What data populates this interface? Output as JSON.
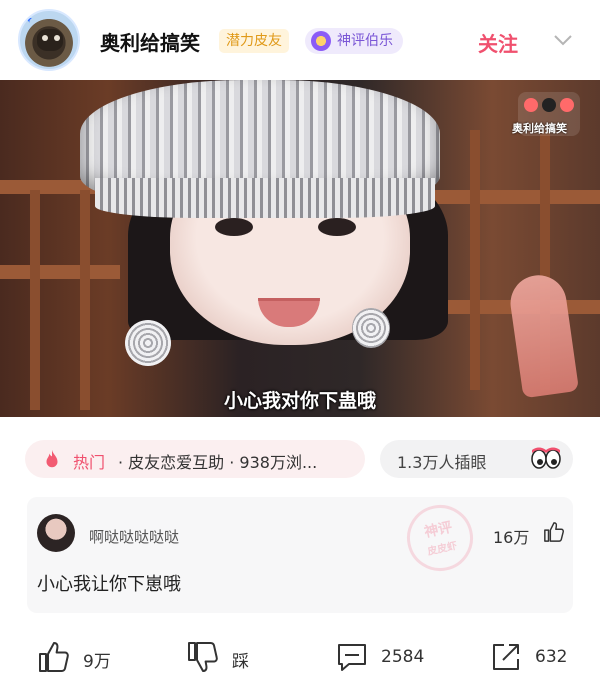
{
  "header": {
    "username": "奥利给搞笑",
    "badge_potential": "潜力皮友",
    "badge_review": "神评伯乐",
    "follow_label": "关注"
  },
  "video": {
    "watermark": "奥利给搞笑",
    "subtitle": "小心我对你下蛊哦"
  },
  "hot_bar": {
    "label": "热门",
    "text": "· 皮友恋爱互助 · 938万浏..."
  },
  "views_bar": {
    "label": "1.3万人插眼"
  },
  "comment": {
    "username": "啊哒哒哒哒哒",
    "likes": "16万",
    "text": "小心我让你下崽哦",
    "stamp_top": "神评",
    "stamp_bottom": "皮皮虾"
  },
  "actions": {
    "like_count": "9万",
    "dislike_label": "踩",
    "comment_count": "2584",
    "share_count": "632"
  },
  "colors": {
    "accent": "#f0506e",
    "badge_gold": "#e09a1a",
    "badge_purple": "#7a56d6"
  }
}
